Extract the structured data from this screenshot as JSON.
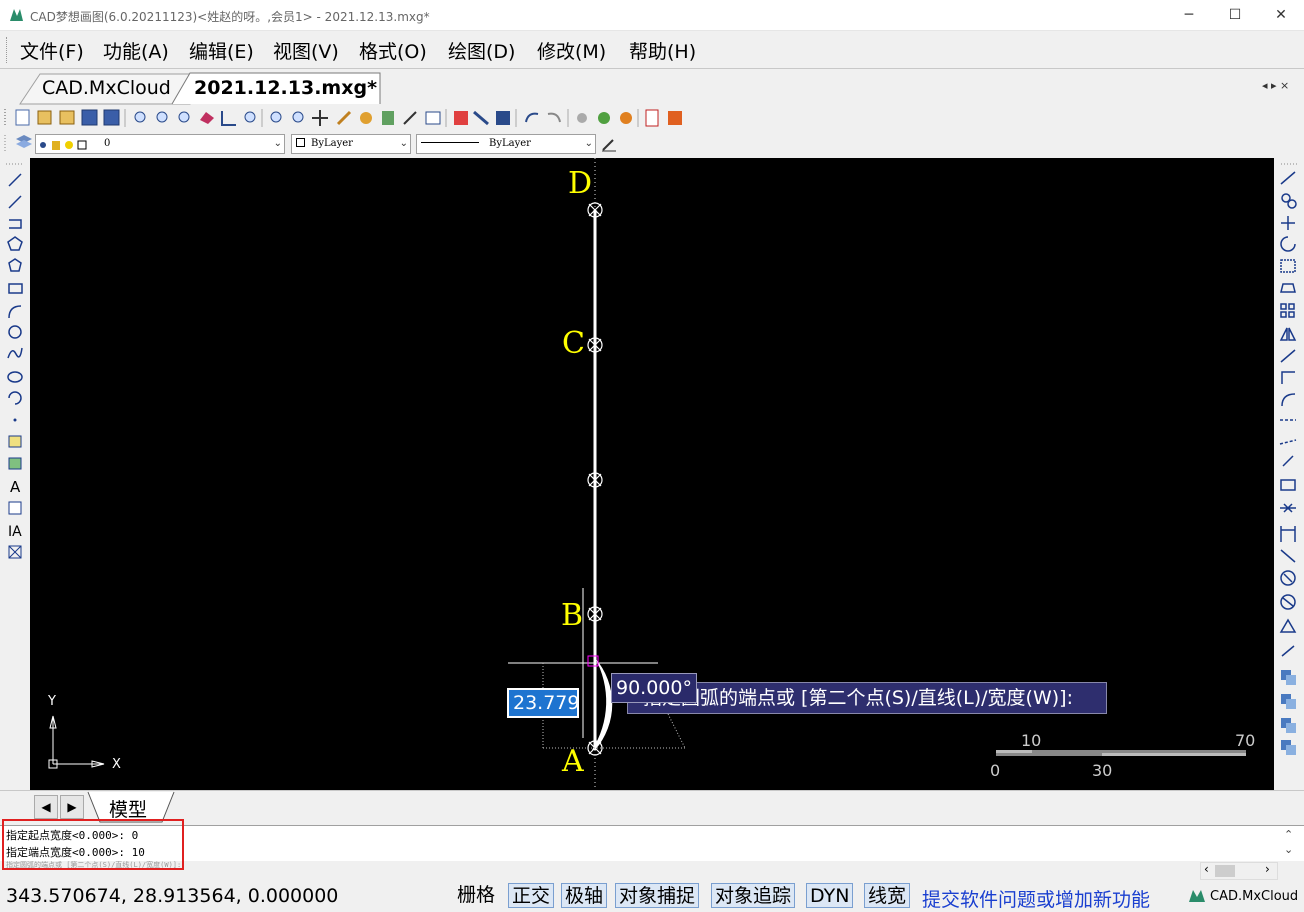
{
  "window": {
    "title": "CAD梦想画图(6.0.20211123)<姓赵的呀。,会员1> - 2021.12.13.mxg*",
    "minimize": "─",
    "maximize": "☐",
    "close": "✕"
  },
  "menu": [
    {
      "label": "文件(F)"
    },
    {
      "label": "功能(A)"
    },
    {
      "label": "编辑(E)"
    },
    {
      "label": "视图(V)"
    },
    {
      "label": "格式(O)"
    },
    {
      "label": "绘图(D)"
    },
    {
      "label": "修改(M)"
    },
    {
      "label": "帮助(H)"
    }
  ],
  "tabs": [
    {
      "label": "CAD.MxCloud"
    },
    {
      "label": "2021.12.13.mxg*"
    }
  ],
  "tab_nav": "◂ ▸ ×",
  "layer_toolbar": {
    "layer_value": "0",
    "color_value": "ByLayer",
    "linetype_value": "ByLayer"
  },
  "drawing": {
    "point_labels": [
      "D",
      "C",
      "B",
      "A"
    ],
    "dyn_input_value": "23.779",
    "dyn_angle": "90.000°",
    "prompt": "指定圆弧的端点或 [第二个点(S)/直线(L)/宽度(W)]:",
    "ucs_y": "Y",
    "ucs_x": "X",
    "scale_top": [
      "10",
      "70"
    ],
    "scale_bottom": [
      "0",
      "30"
    ]
  },
  "layout_tabs": {
    "model": "模型"
  },
  "command_lines": [
    "指定起点宽度<0.000>: 0",
    "指定端点宽度<0.000>: 10",
    "指定圆弧的端点或 [第二个点(S)/直线(L)/宽度(W)]:"
  ],
  "status": {
    "coords": "343.570674,  28.913564,  0.000000",
    "toggles": [
      {
        "label": "栅格",
        "on": false
      },
      {
        "label": "正交",
        "on": true
      },
      {
        "label": "极轴",
        "on": true
      },
      {
        "label": "对象捕捉",
        "on": true
      },
      {
        "label": "对象追踪",
        "on": true
      },
      {
        "label": "DYN",
        "on": true
      },
      {
        "label": "线宽",
        "on": true
      }
    ],
    "feedback_link": "提交软件问题或增加新功能",
    "brand": "CAD.MxCloud"
  },
  "colors": {
    "canvas": "#000000",
    "label_yellow": "#ffff00",
    "highlight": "#e02020",
    "link_blue": "#1a3fd0",
    "tooltip_bg": "#2e2e6e"
  }
}
